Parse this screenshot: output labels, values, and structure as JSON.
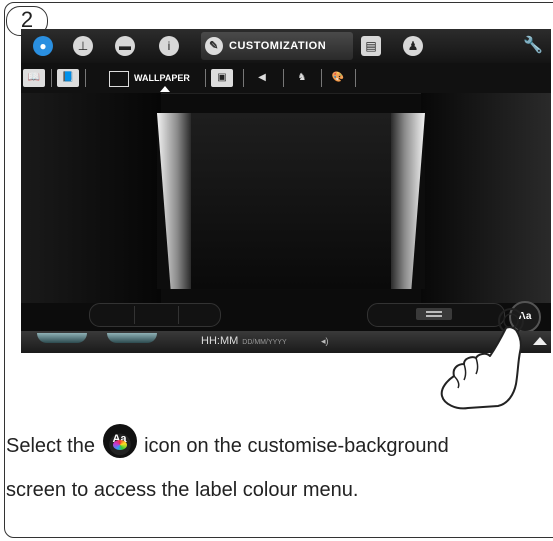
{
  "step": {
    "number": "2"
  },
  "topbar": {
    "icons": [
      "drop-icon",
      "clock-icon",
      "flag-icon",
      "info-icon"
    ],
    "active_tab_label": "CUSTOMIZATION",
    "right_icons": [
      "screen-icon",
      "user-icon"
    ],
    "settings_icon": "wrench-icon"
  },
  "subbar": {
    "icons": [
      "book-icon",
      "book-color-icon"
    ],
    "active_tab_label": "WALLPAPER",
    "right_icons": [
      "frame-icon",
      "speaker-icon",
      "person-icon",
      "palette-icon"
    ]
  },
  "status_bar": {
    "time": "HH:MM",
    "date": "DD/MM/YYYY",
    "volume": "◂)"
  },
  "label_colour_button": {
    "label": "Aa",
    "icon": "label-colour-icon"
  },
  "instruction": {
    "part1": "Select the",
    "part2": "icon on the customise-background",
    "line2": "screen to access the label colour menu."
  },
  "colors": {
    "screen_bg": "#0c0c0c",
    "text": "#222222"
  }
}
